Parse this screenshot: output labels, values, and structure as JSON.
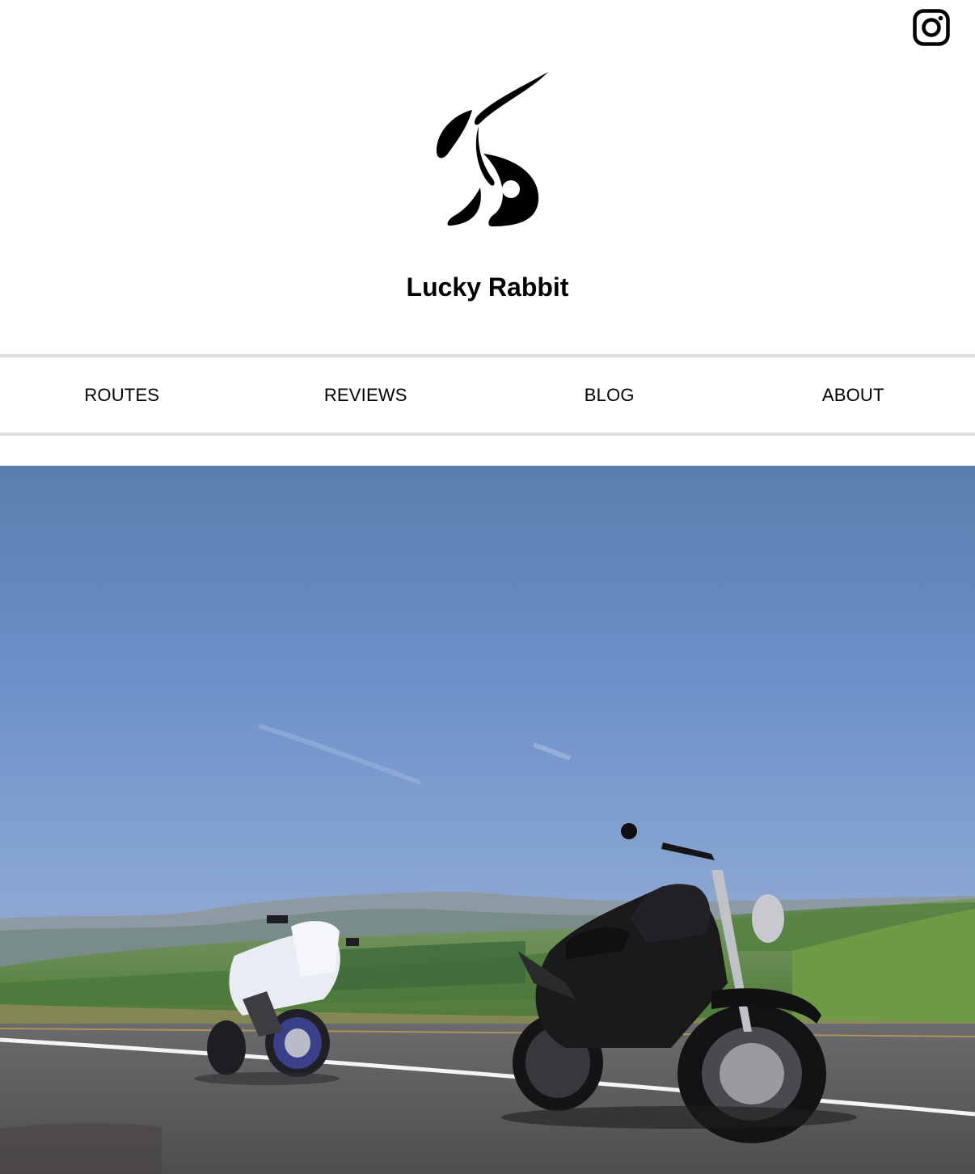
{
  "site": {
    "title": "Lucky Rabbit"
  },
  "header": {
    "social_icon": "instagram-icon",
    "logo_icon": "rabbit-logo-icon"
  },
  "nav": {
    "items": [
      {
        "label": "ROUTES"
      },
      {
        "label": "REVIEWS"
      },
      {
        "label": "BLOG"
      },
      {
        "label": "ABOUT"
      }
    ]
  },
  "hero": {
    "image": "motorcycles-on-highway-photo",
    "alt": "Two motorcycles parked on a highway shoulder with green hills and blue sky"
  },
  "colors": {
    "text": "#000000",
    "divider": "#dcdbe0",
    "sky": "#6a8cc4",
    "road": "#5a5a5c",
    "hills": "#5f8a45"
  }
}
